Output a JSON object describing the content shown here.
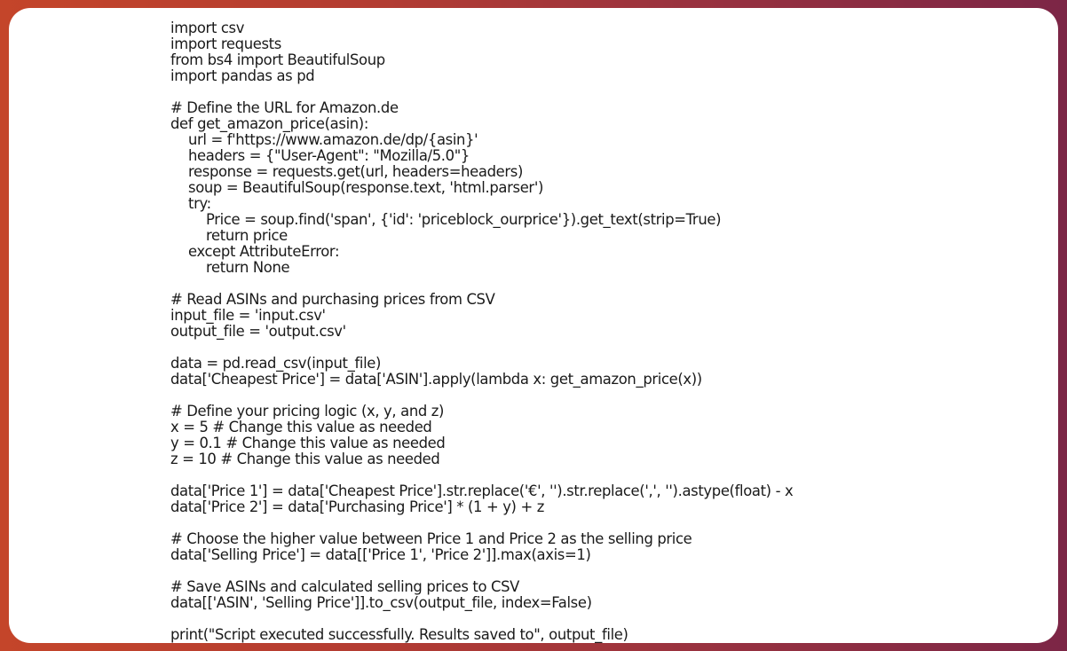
{
  "colors": {
    "background_gradient_start": "#c4452a",
    "background_gradient_end": "#7c2646",
    "panel": "#ffffff",
    "text": "#1a1a1a"
  },
  "code": {
    "language": "python",
    "lines": [
      {
        "indent": 0,
        "text": "import csv"
      },
      {
        "indent": 0,
        "text": "import requests"
      },
      {
        "indent": 0,
        "text": "from bs4 import BeautifulSoup"
      },
      {
        "indent": 0,
        "text": "import pandas as pd"
      },
      {
        "indent": 0,
        "text": ""
      },
      {
        "indent": 0,
        "text": "# Define the URL for Amazon.de"
      },
      {
        "indent": 0,
        "text": "def get_amazon_price(asin):"
      },
      {
        "indent": 1,
        "text": "url = f'https://www.amazon.de/dp/{asin}'"
      },
      {
        "indent": 1,
        "text": "headers = {\"User-Agent\": \"Mozilla/5.0\"}"
      },
      {
        "indent": 1,
        "text": "response = requests.get(url, headers=headers)"
      },
      {
        "indent": 1,
        "text": "soup = BeautifulSoup(response.text, 'html.parser')"
      },
      {
        "indent": 1,
        "text": "try:"
      },
      {
        "indent": 2,
        "text": "Price = soup.find('span', {'id': 'priceblock_ourprice'}).get_text(strip=True)"
      },
      {
        "indent": 2,
        "text": "return price"
      },
      {
        "indent": 1,
        "text": "except AttributeError:"
      },
      {
        "indent": 2,
        "text": "return None"
      },
      {
        "indent": 0,
        "text": ""
      },
      {
        "indent": 0,
        "text": "# Read ASINs and purchasing prices from CSV"
      },
      {
        "indent": 0,
        "text": "input_file = 'input.csv'"
      },
      {
        "indent": 0,
        "text": "output_file = 'output.csv'"
      },
      {
        "indent": 0,
        "text": ""
      },
      {
        "indent": 0,
        "text": "data = pd.read_csv(input_file)"
      },
      {
        "indent": 0,
        "text": "data['Cheapest Price'] = data['ASIN'].apply(lambda x: get_amazon_price(x))"
      },
      {
        "indent": 0,
        "text": ""
      },
      {
        "indent": 0,
        "text": "# Define your pricing logic (x, y, and z)"
      },
      {
        "indent": 0,
        "text": "x = 5 # Change this value as needed"
      },
      {
        "indent": 0,
        "text": "y = 0.1 # Change this value as needed"
      },
      {
        "indent": 0,
        "text": "z = 10 # Change this value as needed"
      },
      {
        "indent": 0,
        "text": ""
      },
      {
        "indent": 0,
        "text": "data['Price 1'] = data['Cheapest Price'].str.replace('€', '').str.replace(',', '').astype(float) - x"
      },
      {
        "indent": 0,
        "text": "data['Price 2'] = data['Purchasing Price'] * (1 + y) + z"
      },
      {
        "indent": 0,
        "text": ""
      },
      {
        "indent": 0,
        "text": "# Choose the higher value between Price 1 and Price 2 as the selling price"
      },
      {
        "indent": 0,
        "text": "data['Selling Price'] = data[['Price 1', 'Price 2']].max(axis=1)"
      },
      {
        "indent": 0,
        "text": ""
      },
      {
        "indent": 0,
        "text": "# Save ASINs and calculated selling prices to CSV"
      },
      {
        "indent": 0,
        "text": "data[['ASIN', 'Selling Price']].to_csv(output_file, index=False)"
      },
      {
        "indent": 0,
        "text": ""
      },
      {
        "indent": 0,
        "text": "print(\"Script executed successfully. Results saved to\", output_file)"
      }
    ]
  }
}
